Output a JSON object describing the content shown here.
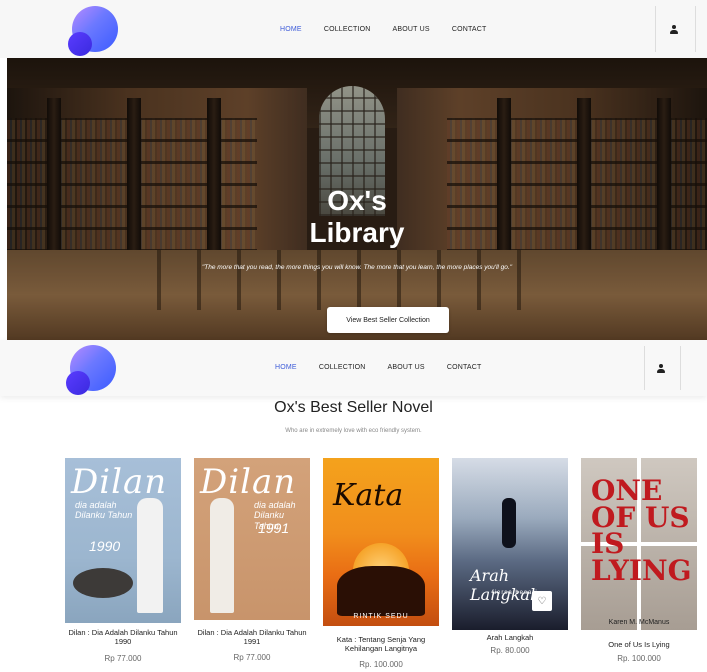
{
  "nav": {
    "links": [
      "HOME",
      "COLLECTION",
      "ABOUT US",
      "CONTACT"
    ],
    "active": "HOME"
  },
  "hero": {
    "title_line1": "Ox's",
    "title_line2": "Library",
    "quote": "\"The more that you read, the more things you will know. The more that you learn, the more places you'll go.\"",
    "button": "View Best Seller Collection"
  },
  "section": {
    "title": "Ox's Best Seller Novel",
    "subtitle": "Who are in extremely love with eco friendly system."
  },
  "books": [
    {
      "title": "Dilan : Dia Adalah Dilanku Tahun 1990",
      "price": "Rp 77.000",
      "cover_word": "Dilan",
      "cover_sub": "dia adalah Dilanku Tahun",
      "cover_year": "1990"
    },
    {
      "title": "Dilan : Dia Adalah Dilanku Tahun 1991",
      "price": "Rp 77.000",
      "cover_word": "Dilan",
      "cover_sub": "dia adalah Dilanku Tahun",
      "cover_year": "1991"
    },
    {
      "title": "Kata : Tentang Senja Yang Kehilangan Langitnya",
      "price": "Rp. 100.000",
      "cover_word": "Kata",
      "cover_author": "RINTIK SEDU"
    },
    {
      "title": "Arah Langkah",
      "price": "Rp. 80.000",
      "cover_word": "Arah Langkah",
      "cover_author": "fiersa besari"
    },
    {
      "title": "One of Us Is Lying",
      "price": "Rp. 100.000",
      "cover_word": "ONE OF US IS LYING",
      "cover_author": "Karen M. McManus"
    }
  ]
}
